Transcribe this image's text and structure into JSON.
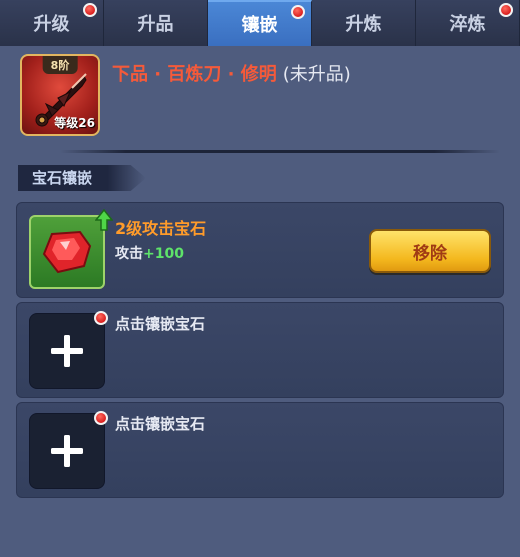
{
  "tabs": [
    {
      "label": "升级",
      "active": false,
      "notify": true
    },
    {
      "label": "升品",
      "active": false,
      "notify": false
    },
    {
      "label": "镶嵌",
      "active": true,
      "notify": true
    },
    {
      "label": "升炼",
      "active": false,
      "notify": false
    },
    {
      "label": "淬炼",
      "active": false,
      "notify": true
    }
  ],
  "item": {
    "tier": "8阶",
    "level_label": "等级26",
    "name": "下品 · 百炼刀 · 修明",
    "status": "(未升品)",
    "icon": "blade-weapon-icon"
  },
  "section": {
    "label": "宝石镶嵌"
  },
  "slots": [
    {
      "filled": true,
      "gem_name": "2级攻击宝石",
      "stat_label": "攻击",
      "stat_value": "+100",
      "action_label": "移除",
      "icon": "red-gem-icon",
      "upgrade_icon": "green-up-arrow-icon"
    },
    {
      "filled": false,
      "prompt": "点击镶嵌宝石",
      "icon": "plus-icon"
    },
    {
      "filled": false,
      "prompt": "点击镶嵌宝石",
      "icon": "plus-icon"
    }
  ],
  "colors": {
    "background": "#4f5c7e",
    "active_tab": "#4b87d6",
    "item_name": "#f55a3a",
    "gem_name": "#ff9b2a",
    "stat_value": "#5ee36a",
    "button": "#f4b81e",
    "notification": "#d91f1f"
  }
}
